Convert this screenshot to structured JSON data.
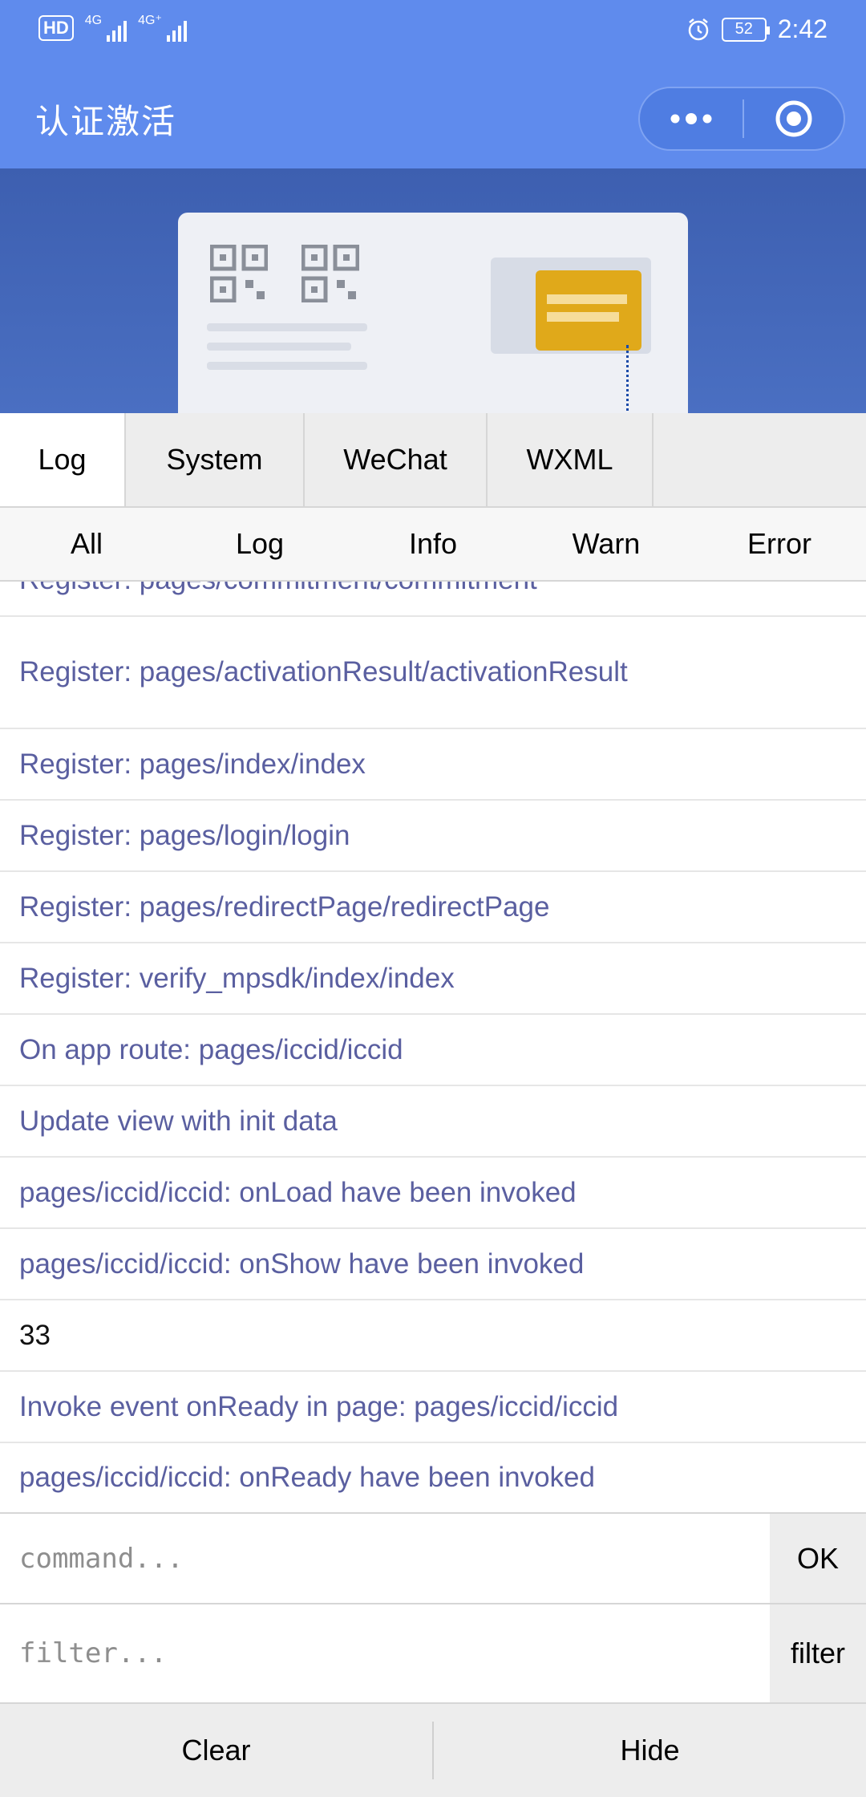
{
  "status_bar": {
    "hd_label": "HD",
    "net1_label": "4G",
    "net2_label": "4G⁺",
    "battery": "52",
    "time": "2:42"
  },
  "nav": {
    "title": "认证激活",
    "more_icon": "more-dots-icon",
    "close_icon": "record-circle-icon",
    "bar_color": "#5f8bed"
  },
  "console": {
    "tabs": [
      "Log",
      "System",
      "WeChat",
      "WXML"
    ],
    "active_tab": "Log",
    "levels": [
      "All",
      "Log",
      "Info",
      "Warn",
      "Error"
    ],
    "logs": [
      {
        "text": "Register: pages/commitment/commitment",
        "type": "system"
      },
      {
        "text": "Register: pages/activationResult/activationResult",
        "type": "system"
      },
      {
        "text": "Register: pages/index/index",
        "type": "system"
      },
      {
        "text": "Register: pages/login/login",
        "type": "system"
      },
      {
        "text": "Register: pages/redirectPage/redirectPage",
        "type": "system"
      },
      {
        "text": "Register: verify_mpsdk/index/index",
        "type": "system"
      },
      {
        "text": "On app route: pages/iccid/iccid",
        "type": "system"
      },
      {
        "text": "Update view with init data",
        "type": "system"
      },
      {
        "text": "pages/iccid/iccid: onLoad have been invoked",
        "type": "system"
      },
      {
        "text": "pages/iccid/iccid: onShow have been invoked",
        "type": "system"
      },
      {
        "text": "33",
        "type": "log"
      },
      {
        "text": "Invoke event onReady in page: pages/iccid/iccid",
        "type": "system"
      },
      {
        "text": "pages/iccid/iccid: onReady have been invoked",
        "type": "system"
      }
    ],
    "command": {
      "placeholder": "command...",
      "button": "OK"
    },
    "filter": {
      "placeholder": "filter...",
      "button": "filter"
    },
    "footer": {
      "clear": "Clear",
      "hide": "Hide"
    },
    "system_log_color": "#5a5fa0"
  }
}
